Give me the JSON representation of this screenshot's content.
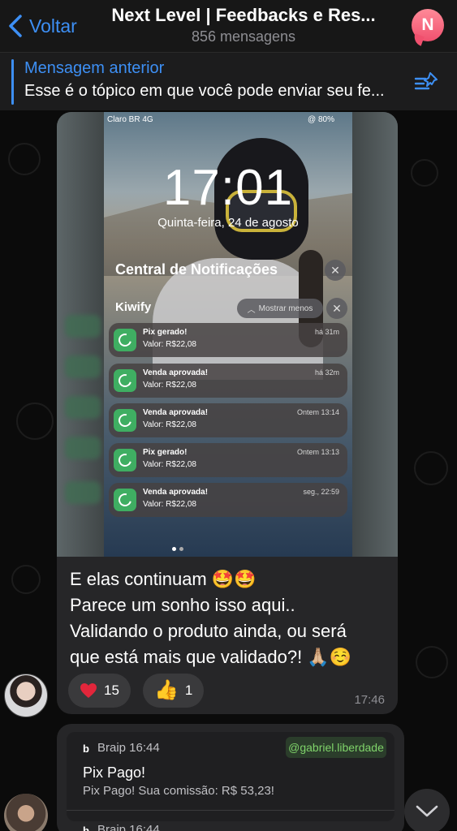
{
  "header": {
    "back_label": "Voltar",
    "title": "Next Level | Feedbacks e Res...",
    "subtitle": "856 mensagens",
    "avatar_letter": "N"
  },
  "pinned": {
    "title": "Mensagem anterior",
    "text": "Esse é o tópico em que você pode enviar seu fe..."
  },
  "message1": {
    "screenshot": {
      "carrier": "Claro BR  4G",
      "battery": "@ 80%",
      "time": "17:01",
      "date": "Quinta-feira, 24 de agosto",
      "notification_center": "Central de Notificações",
      "app_name": "Kiwify",
      "show_less": "Mostrar menos",
      "notifications": [
        {
          "title": "Pix gerado!",
          "value": "Valor: R$22,08",
          "time": "há 31m"
        },
        {
          "title": "Venda aprovada!",
          "value": "Valor: R$22,08",
          "time": "há 32m"
        },
        {
          "title": "Venda aprovada!",
          "value": "Valor: R$22,08",
          "time": "Ontem 13:14"
        },
        {
          "title": "Pix gerado!",
          "value": "Valor: R$22,08",
          "time": "Ontem 13:13"
        },
        {
          "title": "Venda aprovada!",
          "value": "Valor: R$22,08",
          "time": "seg., 22:59"
        }
      ]
    },
    "text_line1": "E elas continuam 🤩🤩",
    "text_line2": "Parece um sonho isso aqui..",
    "text_line3": "Validando o produto ainda, ou será",
    "text_line4": "que está mais que validado?! 🙏🏼☺️",
    "reactions": [
      {
        "icon": "heart-icon",
        "count": "15"
      },
      {
        "icon": "thumbs-up-icon",
        "count": "1"
      }
    ],
    "time": "17:46"
  },
  "message2": {
    "badge": "b",
    "sender": "Braip  16:44",
    "handle": "@gabriel.liberdade",
    "title": "Pix Pago!",
    "body": "Pix Pago! Sua comissão: R$ 53,23!",
    "sender2": "Braip  16:44"
  },
  "colors": {
    "accent": "#3d8ff4",
    "bubble": "#262628",
    "notif_green": "#3fae62"
  }
}
